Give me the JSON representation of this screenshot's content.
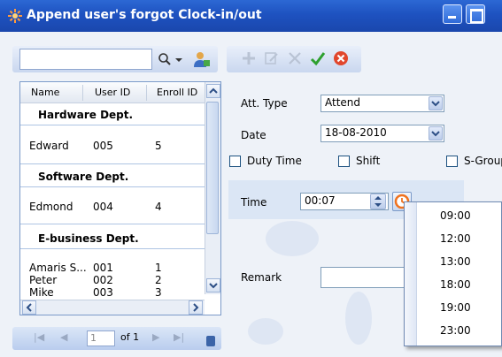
{
  "window": {
    "title": "Append user's forgot Clock-in/out"
  },
  "search": {
    "value": ""
  },
  "grid": {
    "columns": [
      "Name",
      "User ID",
      "Enroll ID"
    ],
    "groups": [
      {
        "label": "Hardware Dept.",
        "rows": [
          {
            "name": "Edward",
            "user_id": "005",
            "enroll_id": "5"
          }
        ]
      },
      {
        "label": "Software Dept.",
        "rows": [
          {
            "name": "Edmond",
            "user_id": "004",
            "enroll_id": "4"
          }
        ]
      },
      {
        "label": "E-business Dept.",
        "rows": [
          {
            "name": "Amaris S...",
            "user_id": "001",
            "enroll_id": "1"
          },
          {
            "name": "Peter",
            "user_id": "002",
            "enroll_id": "2"
          },
          {
            "name": "Mike",
            "user_id": "003",
            "enroll_id": "3"
          }
        ]
      }
    ]
  },
  "pager": {
    "page": "1",
    "of_label": "of 1"
  },
  "form": {
    "att_type_label": "Att. Type",
    "att_type_value": "Attend",
    "date_label": "Date",
    "date_value": "18-08-2010",
    "duty_time_label": "Duty Time",
    "shift_label": "Shift",
    "sgroup_label": "S-Group",
    "time_label": "Time",
    "time_value": "00:07",
    "remark_label": "Remark"
  },
  "time_presets": [
    "09:00",
    "12:00",
    "13:00",
    "18:00",
    "19:00",
    "23:00"
  ]
}
